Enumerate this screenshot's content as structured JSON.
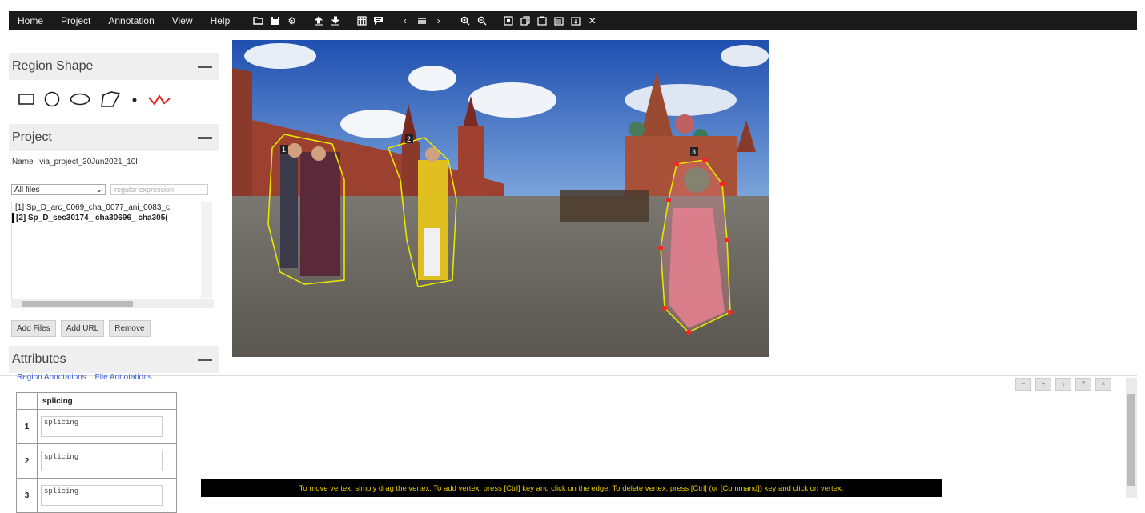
{
  "menu": [
    "Home",
    "Project",
    "Annotation",
    "View",
    "Help"
  ],
  "toolbar_icons": [
    "folder-icon",
    "save-icon",
    "gear-icon",
    "upload-icon",
    "download-icon",
    "grid-icon",
    "comment-icon",
    "prev-icon",
    "list-icon",
    "next-icon",
    "zoom-in-icon",
    "zoom-out-icon",
    "select-all-icon",
    "copy-icon",
    "paste-icon",
    "paste-all-icon",
    "delete-region-icon",
    "close-icon"
  ],
  "sidebar": {
    "region_shape_title": "Region Shape",
    "project_title": "Project",
    "name_label": "Name",
    "name_value": "via_project_30Jun2021_10l",
    "filter_select": "All files",
    "filter_placeholder": "regular expression",
    "files": [
      "[1] Sp_D_arc_0069_cha_0077_ani_0083_c",
      "[2] Sp_D_sec30174_ cha30696_ cha305("
    ],
    "buttons": {
      "add_files": "Add Files",
      "add_url": "Add URL",
      "remove": "Remove"
    },
    "attributes_title": "Attributes"
  },
  "annotation_tabs": [
    "Region Annotations",
    "File Annotations"
  ],
  "attr_table": {
    "header": "splicing",
    "rows": [
      {
        "num": "1",
        "value": "splicing"
      },
      {
        "num": "2",
        "value": "splicing"
      },
      {
        "num": "3",
        "value": "splicing"
      }
    ]
  },
  "status_message": "To move vertex, simply drag the vertex. To add vertex, press [Ctrl] key and click on the edge. To delete vertex, press [Ctrl] (or [Command]) key and click on vertex.",
  "region_ids": [
    "1",
    "2",
    "3"
  ],
  "colors": {
    "topbar": "#1b1b1b",
    "region_outline": "#e6e600",
    "vertex": "#ff2020",
    "status_text": "#e6c800"
  }
}
